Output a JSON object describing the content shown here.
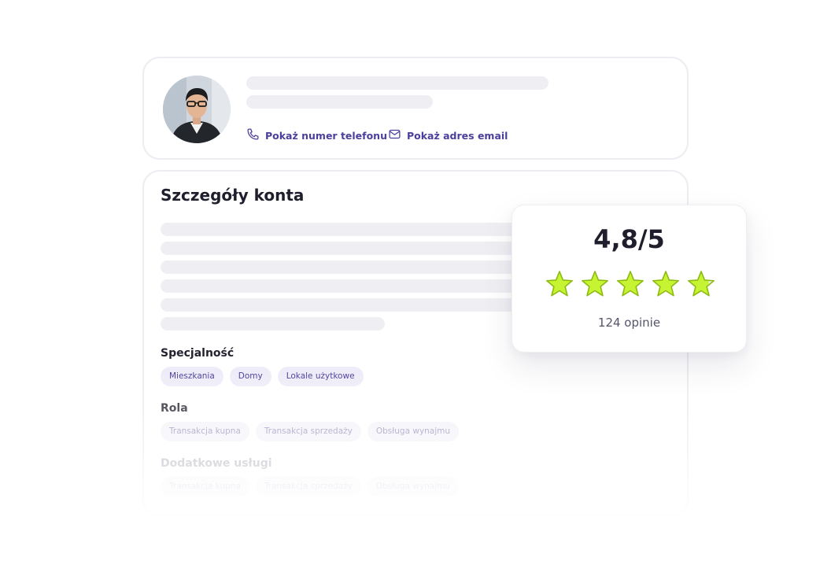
{
  "profile": {
    "avatar_alt": "agent photo",
    "phone_link": "Pokaż numer telefonu",
    "email_link": "Pokaż adres email",
    "phone_icon": "phone-icon",
    "email_icon": "mail-icon"
  },
  "details": {
    "title": "Szczegóły konta",
    "sections": [
      {
        "label": "Specjalność",
        "chips": [
          "Mieszkania",
          "Domy",
          "Lokale użytkowe"
        ]
      },
      {
        "label": "Rola",
        "chips": [
          "Transakcja kupna",
          "Transakcja sprzedaży",
          "Obsługa wynajmu"
        ]
      },
      {
        "label": "Dodatkowe usługi",
        "chips": [
          "Transakcja kupna",
          "Transakcja sprzedaży",
          "Obsługa wynajmu"
        ]
      }
    ]
  },
  "rating": {
    "score": "4,8/5",
    "value": 4.8,
    "max": 5,
    "reviews": "124 opinie",
    "star_color": "#c6f432",
    "star_stroke": "#8dba12"
  },
  "colors": {
    "accent": "#4a3f9d",
    "chip_bg": "#eeecf8",
    "skeleton": "#efeff3",
    "card_border": "#ececf1"
  }
}
